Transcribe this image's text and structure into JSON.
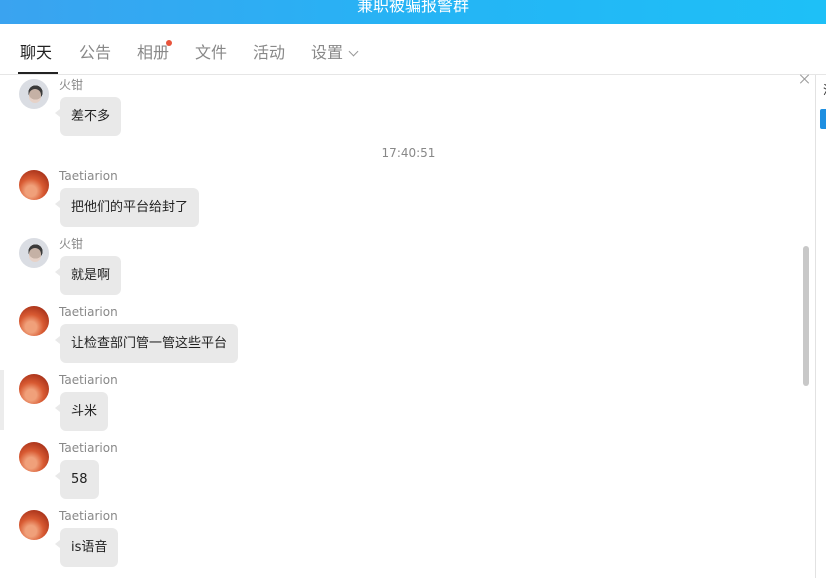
{
  "window": {
    "title": "兼职被骗报警群"
  },
  "tabs": [
    {
      "label": "聊天"
    },
    {
      "label": "公告"
    },
    {
      "label": "相册"
    },
    {
      "label": "文件"
    },
    {
      "label": "活动"
    },
    {
      "label": "设置"
    }
  ],
  "chat": {
    "timestamp": "17:40:51",
    "messages": [
      {
        "sender": "火钳",
        "text": "差不多"
      },
      {
        "sender": "Taetiarion",
        "text": "把他们的平台给封了"
      },
      {
        "sender": "火钳",
        "text": "就是啊"
      },
      {
        "sender": "Taetiarion",
        "text": "让检查部门管一管这些平台"
      },
      {
        "sender": "Taetiarion",
        "text": "斗米"
      },
      {
        "sender": "Taetiarion",
        "text": "58"
      },
      {
        "sender": "Taetiarion",
        "text": "is语音"
      }
    ]
  },
  "right_panel": {
    "text": "活"
  },
  "colors": {
    "title_gradient_start": "#3aa3f0",
    "title_gradient_end": "#1ec0f7",
    "notification_dot": "#e8543c",
    "bubble_bg": "#e9e9e9",
    "accent": "#1e8fe1"
  }
}
